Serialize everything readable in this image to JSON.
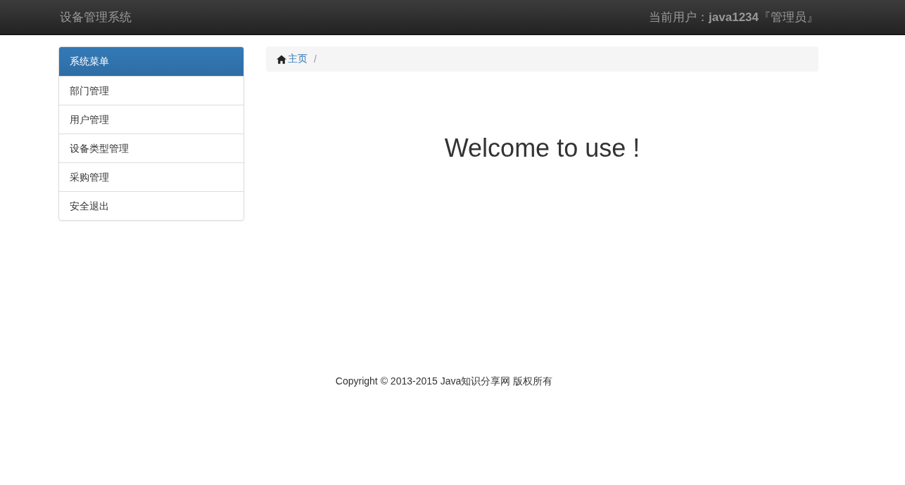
{
  "navbar": {
    "brand": "设备管理系统",
    "user": "当前用户：**java1234**『管理员』"
  },
  "sidebar": {
    "title": "系统菜单",
    "items": [
      {
        "label": "部门管理"
      },
      {
        "label": "用户管理"
      },
      {
        "label": "设备类型管理"
      },
      {
        "label": "采购管理"
      },
      {
        "label": "安全退出"
      }
    ]
  },
  "breadcrumb": {
    "items": [
      {
        "label": "主页"
      }
    ],
    "separator": "/"
  },
  "welcome": "Welcome to use !",
  "footer": "Copyright © 2013-2015 Java知识分享网 版权所有"
}
